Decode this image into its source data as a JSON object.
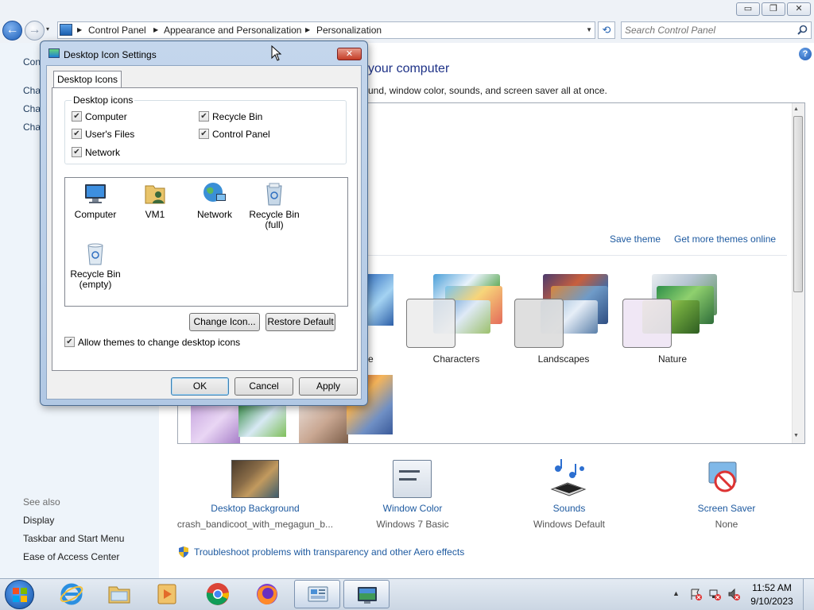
{
  "window": {
    "min_label": "▭",
    "max_label": "❐",
    "close_label": "✕"
  },
  "nav": {
    "back_label": "←",
    "forward_label": "→",
    "recent_label": "▾",
    "breadcrumbs": [
      "Control Panel",
      "Appearance and Personalization",
      "Personalization"
    ],
    "refresh_label": "⟲",
    "search_placeholder": "Search Control Panel"
  },
  "left_pane": {
    "links": [
      "Con",
      "Cha",
      "Cha",
      "Cha"
    ],
    "see_also_heading": "See also",
    "see_also_links": [
      "Display",
      "Taskbar and Start Menu",
      "Ease of Access Center"
    ]
  },
  "main": {
    "help_label": "?",
    "title": "your computer",
    "description": "und, window color, sounds, and screen saver all at once.",
    "save_theme": "Save theme",
    "more_themes": "Get more themes online",
    "partial_theme_label": "e",
    "themes": [
      {
        "name": "Characters"
      },
      {
        "name": "Landscapes"
      },
      {
        "name": "Nature"
      }
    ]
  },
  "bottom": {
    "items": [
      {
        "link": "Desktop Background",
        "sub": "crash_bandicoot_with_megagun_b...",
        "icon": "desktop-background-icon"
      },
      {
        "link": "Window Color",
        "sub": "Windows 7 Basic",
        "icon": "window-color-icon"
      },
      {
        "link": "Sounds",
        "sub": "Windows Default",
        "icon": "sounds-icon"
      },
      {
        "link": "Screen Saver",
        "sub": "None",
        "icon": "screen-saver-icon"
      }
    ],
    "troubleshoot": "Troubleshoot problems with transparency and other Aero effects"
  },
  "dialog": {
    "title": "Desktop Icon Settings",
    "close_label": "✕",
    "tab": "Desktop Icons",
    "group_title": "Desktop icons",
    "checkboxes": [
      {
        "label": "Computer",
        "checked": true
      },
      {
        "label": "Recycle Bin",
        "checked": true
      },
      {
        "label": "User's Files",
        "checked": true
      },
      {
        "label": "Control Panel",
        "checked": true
      },
      {
        "label": "Network",
        "checked": true
      }
    ],
    "icons": [
      {
        "label": "Computer",
        "icon": "computer-icon"
      },
      {
        "label": "VM1",
        "icon": "user-folder-icon"
      },
      {
        "label": "Network",
        "icon": "network-icon"
      },
      {
        "label": "Recycle Bin (full)",
        "icon": "recycle-bin-full-icon"
      },
      {
        "label": "Recycle Bin (empty)",
        "icon": "recycle-bin-empty-icon"
      }
    ],
    "change_icon": "Change Icon...",
    "restore_default": "Restore Default",
    "allow_themes": "Allow themes to change desktop icons",
    "allow_themes_checked": true,
    "ok": "OK",
    "cancel": "Cancel",
    "apply": "Apply",
    "check_mark": "✔"
  },
  "taskbar": {
    "time": "11:52 AM",
    "date": "9/10/2023",
    "tray_arrow": "▲"
  },
  "colors": {
    "link_blue": "#1e5aa0",
    "title_blue": "#1e3287",
    "left_pane_bg": "#eef4fa",
    "dialog_frame": "#b1c8e4",
    "close_red": "#c43c26"
  }
}
